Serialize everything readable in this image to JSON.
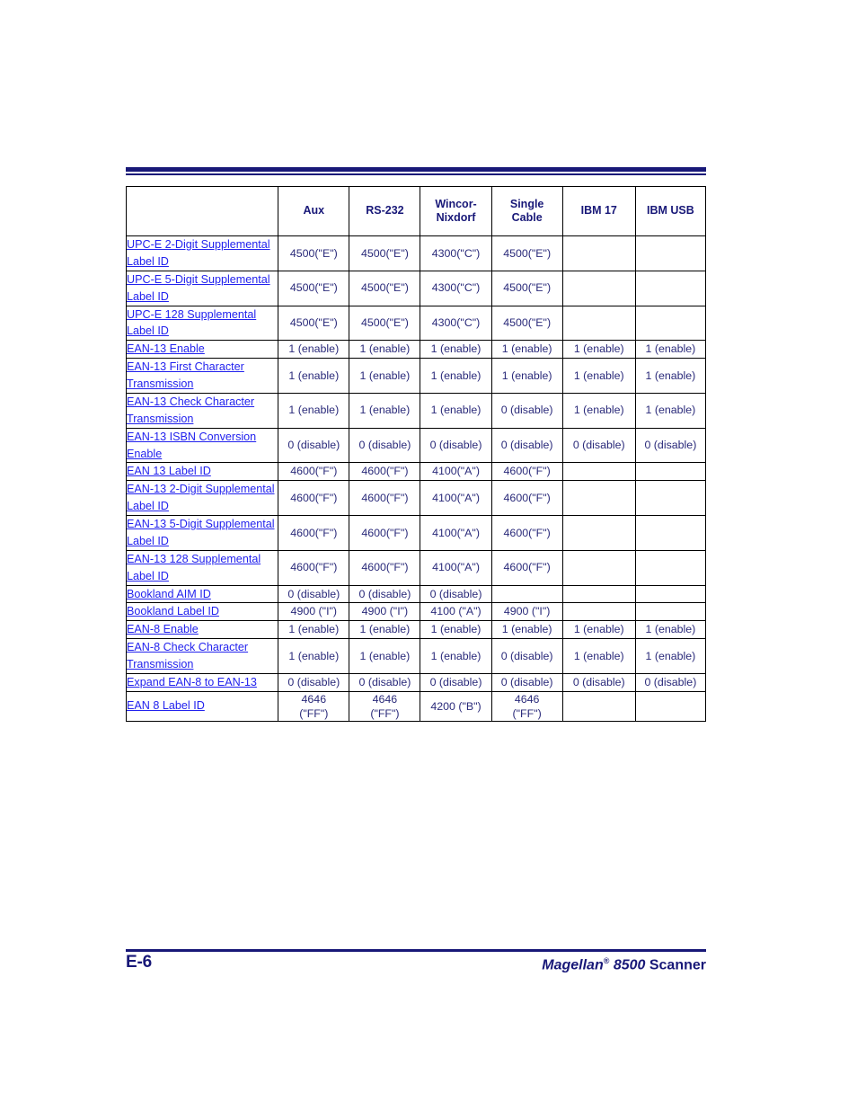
{
  "page": {
    "footer_page_number": "E-6",
    "footer_title_italic": "Magellan",
    "footer_registered_mark": "®",
    "footer_model": " 8500 ",
    "footer_product": "Scanner",
    "accent_color": "#181878",
    "link_color": "#2222ee",
    "value_color": "#2a2a7a"
  },
  "table": {
    "headers": [
      "",
      "Aux",
      "RS-232",
      "Wincor-\nNixdorf",
      "Single\nCable",
      "IBM 17",
      "IBM USB"
    ],
    "headers_flat": {
      "blank": "",
      "aux": "Aux",
      "rs232": "RS-232",
      "wincor_line1": "Wincor-",
      "wincor_line2": "Nixdorf",
      "single_line1": "Single",
      "single_line2": "Cable",
      "ibm17": "IBM 17",
      "ibmusb": "IBM USB"
    },
    "rows": [
      {
        "name": "UPC-E 2-Digit Supplemental Label ID",
        "aux": "4500(\"E\")",
        "rs232": "4500(\"E\")",
        "wincor": "4300(\"C\")",
        "single": "4500(\"E\")",
        "ibm17": "",
        "ibmusb": ""
      },
      {
        "name": "UPC-E 5-Digit Supplemental Label ID",
        "aux": "4500(\"E\")",
        "rs232": "4500(\"E\")",
        "wincor": "4300(\"C\")",
        "single": "4500(\"E\")",
        "ibm17": "",
        "ibmusb": ""
      },
      {
        "name": "UPC-E 128 Supplemental Label ID",
        "aux": "4500(\"E\")",
        "rs232": "4500(\"E\")",
        "wincor": "4300(\"C\")",
        "single": "4500(\"E\")",
        "ibm17": "",
        "ibmusb": ""
      },
      {
        "name": "EAN-13 Enable",
        "aux": "1 (enable)",
        "rs232": "1 (enable)",
        "wincor": "1 (enable)",
        "single": "1 (enable)",
        "ibm17": "1 (enable)",
        "ibmusb": "1 (enable)"
      },
      {
        "name": "EAN-13 First Character Transmission",
        "aux": "1 (enable)",
        "rs232": "1 (enable)",
        "wincor": "1 (enable)",
        "single": "1 (enable)",
        "ibm17": "1 (enable)",
        "ibmusb": "1 (enable)"
      },
      {
        "name": "EAN-13 Check Character Transmission",
        "aux": "1 (enable)",
        "rs232": "1 (enable)",
        "wincor": "1 (enable)",
        "single": "0 (disable)",
        "ibm17": "1 (enable)",
        "ibmusb": "1 (enable)"
      },
      {
        "name": "EAN-13 ISBN Conversion Enable",
        "aux": "0 (disable)",
        "rs232": "0 (disable)",
        "wincor": "0 (disable)",
        "single": "0 (disable)",
        "ibm17": "0 (disable)",
        "ibmusb": "0 (disable)"
      },
      {
        "name": "EAN 13 Label ID",
        "aux": "4600(\"F\")",
        "rs232": "4600(\"F\")",
        "wincor": "4100(\"A\")",
        "single": "4600(\"F\")",
        "ibm17": "",
        "ibmusb": ""
      },
      {
        "name": "EAN-13 2-Digit Supplemental Label ID",
        "aux": "4600(\"F\")",
        "rs232": "4600(\"F\")",
        "wincor": "4100(\"A\")",
        "single": "4600(\"F\")",
        "ibm17": "",
        "ibmusb": ""
      },
      {
        "name": "EAN-13 5-Digit Supplemental Label ID",
        "aux": "4600(\"F\")",
        "rs232": "4600(\"F\")",
        "wincor": "4100(\"A\")",
        "single": "4600(\"F\")",
        "ibm17": "",
        "ibmusb": ""
      },
      {
        "name": "EAN-13 128 Supplemental Label ID",
        "aux": "4600(\"F\")",
        "rs232": "4600(\"F\")",
        "wincor": "4100(\"A\")",
        "single": "4600(\"F\")",
        "ibm17": "",
        "ibmusb": ""
      },
      {
        "name": "Bookland AIM ID",
        "aux": "0 (disable)",
        "rs232": "0 (disable)",
        "wincor": "0 (disable)",
        "single": "",
        "ibm17": "",
        "ibmusb": ""
      },
      {
        "name": "Bookland Label ID",
        "aux": "4900 (\"I\")",
        "rs232": "4900 (\"I\")",
        "wincor": "4100 (\"A\")",
        "single": "4900 (\"I\")",
        "ibm17": "",
        "ibmusb": ""
      },
      {
        "name": "EAN-8 Enable",
        "aux": "1 (enable)",
        "rs232": "1 (enable)",
        "wincor": "1 (enable)",
        "single": "1 (enable)",
        "ibm17": "1 (enable)",
        "ibmusb": "1 (enable)"
      },
      {
        "name": "EAN-8 Check Character Transmission",
        "aux": "1 (enable)",
        "rs232": "1 (enable)",
        "wincor": "1 (enable)",
        "single": "0 (disable)",
        "ibm17": "1 (enable)",
        "ibmusb": "1 (enable)"
      },
      {
        "name": "Expand EAN-8 to EAN-13",
        "aux": "0 (disable)",
        "rs232": "0 (disable)",
        "wincor": "0 (disable)",
        "single": "0 (disable)",
        "ibm17": "0 (disable)",
        "ibmusb": "0 (disable)"
      },
      {
        "name": "EAN 8 Label ID",
        "aux": "4646\n(\"FF\")",
        "rs232": "4646\n(\"FF\")",
        "wincor": "4200 (\"B\")",
        "single": "4646\n(\"FF\")",
        "ibm17": "",
        "ibmusb": ""
      }
    ]
  }
}
